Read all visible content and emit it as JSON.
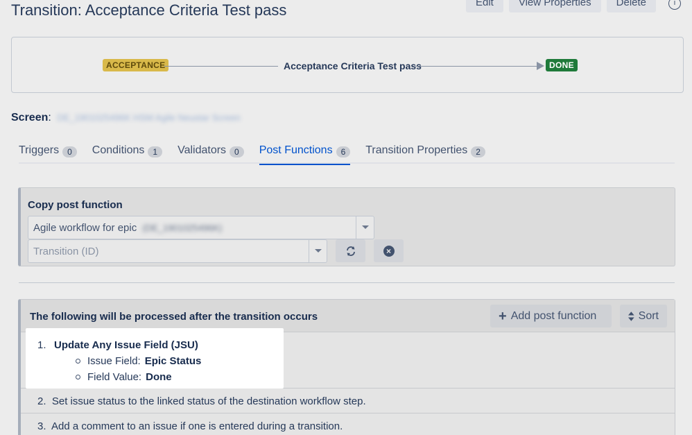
{
  "page": {
    "title": "Transition: Acceptance Criteria Test pass",
    "header_buttons": {
      "edit": "Edit",
      "view_properties": "View Properties",
      "delete": "Delete"
    },
    "help_icon": "i"
  },
  "diagram": {
    "from_status": "ACCEPTANCE",
    "transition": "Acceptance Criteria Test pass",
    "to_status": "DONE"
  },
  "screen": {
    "label": "Screen",
    "separator": ":",
    "value": "DE_1901025496K HSM Agile Neustar Screen"
  },
  "tabs": [
    {
      "label": "Triggers",
      "count": "0"
    },
    {
      "label": "Conditions",
      "count": "1"
    },
    {
      "label": "Validators",
      "count": "0"
    },
    {
      "label": "Post Functions",
      "count": "6"
    },
    {
      "label": "Transition Properties",
      "count": "2"
    }
  ],
  "copy_panel": {
    "title": "Copy post function",
    "workflow_value": "Agile workflow for epic",
    "workflow_blurred": "(DE_1901025496K)",
    "transition_placeholder": "Transition (ID)"
  },
  "post_functions": {
    "heading": "The following will be processed after the transition occurs",
    "add_label": "Add post function",
    "sort_label": "Sort",
    "items": [
      {
        "num": "1.",
        "title": "Update Any Issue Field (JSU)",
        "field_label": "Issue Field:",
        "field_value": "Epic Status",
        "value_label": "Field Value:",
        "value_value": "Done"
      },
      {
        "num": "2.",
        "text": "Set issue status to the linked status of the destination workflow step."
      },
      {
        "num": "3.",
        "text": "Add a comment to an issue if one is entered during a transition."
      }
    ]
  }
}
